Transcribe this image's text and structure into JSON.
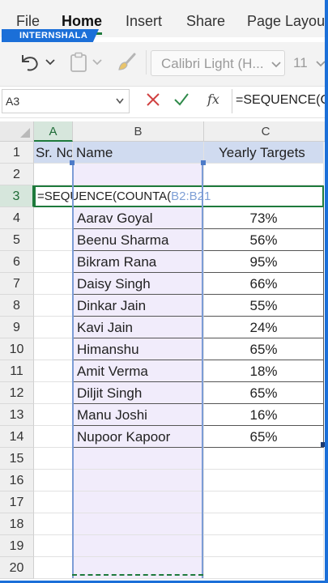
{
  "ribbon": {
    "tabs": [
      {
        "label": "File",
        "active": false
      },
      {
        "label": "Home",
        "active": true
      },
      {
        "label": "Insert",
        "active": false
      },
      {
        "label": "Share",
        "active": false
      },
      {
        "label": "Page Layout",
        "active": false
      }
    ],
    "brand": "INTERNSHALA"
  },
  "toolbar": {
    "undo_icon": "undo-icon",
    "paste_icon": "clipboard-icon",
    "format_painter_icon": "paintbrush-icon",
    "font_name": "Calibri Light (H...",
    "font_size": "11"
  },
  "formula_bar": {
    "name_box": "A3",
    "formula": "=SEQUENCE(C"
  },
  "sheet": {
    "columns": [
      "A",
      "B",
      "C"
    ],
    "rows": [
      "1",
      "2",
      "3",
      "4",
      "5",
      "6",
      "7",
      "8",
      "9",
      "10",
      "11",
      "12",
      "13",
      "14",
      "15",
      "16",
      "17",
      "18",
      "19",
      "20"
    ],
    "header": {
      "a": "Sr. No",
      "b": "Name",
      "c": "Yearly Targets"
    },
    "editing": {
      "prefix": "=SEQUENCE(COUNTA(",
      "ref": "B2:B21"
    },
    "records": [
      {
        "name": "Aarav Goyal",
        "target": "73%"
      },
      {
        "name": "Beenu Sharma",
        "target": "56%"
      },
      {
        "name": "Bikram Rana",
        "target": "95%"
      },
      {
        "name": "Daisy Singh",
        "target": "66%"
      },
      {
        "name": "Dinkar Jain",
        "target": "55%"
      },
      {
        "name": "Kavi Jain",
        "target": "24%"
      },
      {
        "name": "Himanshu",
        "target": "65%"
      },
      {
        "name": "Amit Verma",
        "target": "18%"
      },
      {
        "name": "Diljit Singh",
        "target": "65%"
      },
      {
        "name": "Manu Joshi",
        "target": "16%"
      },
      {
        "name": "Nupoor Kapoor",
        "target": "65%"
      }
    ]
  },
  "colors": {
    "accent_green": "#1e7a3c",
    "header_fill": "#d0dbf0",
    "range_fill": "#f1ecfb",
    "brand_blue": "#1b6fd8"
  }
}
